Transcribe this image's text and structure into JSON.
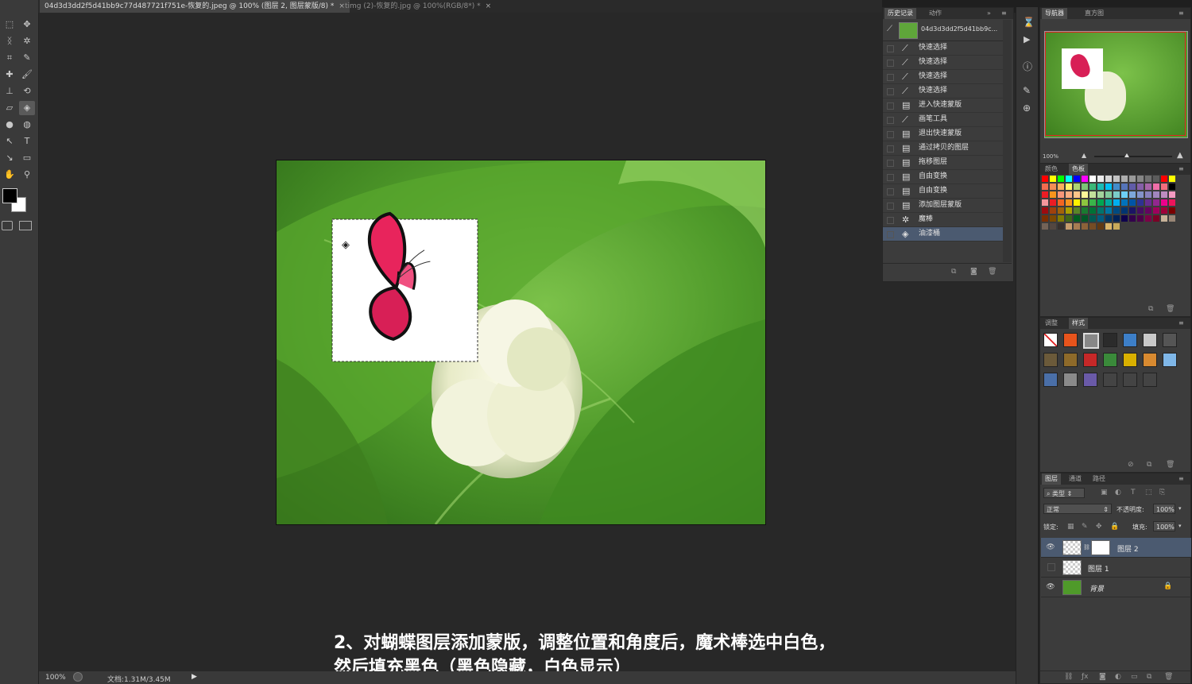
{
  "tabs": [
    {
      "label": "04d3d3dd2f5d41bb9c77d487721f751e-恢复的.jpeg @ 100% (图层 2, 图层蒙版/8) *",
      "close": "×"
    },
    {
      "label": "timg (2)-恢复的.jpg @ 100%(RGB/8*) *",
      "close": "×"
    }
  ],
  "toolbar": {
    "tools": [
      {
        "name": "rect-marquee-icon",
        "glyph": "⬚"
      },
      {
        "name": "move-icon",
        "glyph": "✥"
      },
      {
        "name": "lasso-icon",
        "glyph": "ᛝ"
      },
      {
        "name": "magic-wand-icon",
        "glyph": "✲"
      },
      {
        "name": "crop-icon",
        "glyph": "⌗"
      },
      {
        "name": "eyedropper-icon",
        "glyph": "✎"
      },
      {
        "name": "healing-brush-icon",
        "glyph": "✚"
      },
      {
        "name": "brush-icon",
        "glyph": "🖌"
      },
      {
        "name": "clone-stamp-icon",
        "glyph": "⊥"
      },
      {
        "name": "history-brush-icon",
        "glyph": "⟲"
      },
      {
        "name": "eraser-icon",
        "glyph": "▱"
      },
      {
        "name": "paint-bucket-icon",
        "glyph": "◈"
      },
      {
        "name": "blur-icon",
        "glyph": "●"
      },
      {
        "name": "dodge-icon",
        "glyph": "◍"
      },
      {
        "name": "path-select-icon",
        "glyph": "↖"
      },
      {
        "name": "type-icon",
        "glyph": "T"
      },
      {
        "name": "direct-select-icon",
        "glyph": "↘"
      },
      {
        "name": "shape-icon",
        "glyph": "▭"
      },
      {
        "name": "hand-icon",
        "glyph": "✋"
      },
      {
        "name": "zoom-icon",
        "glyph": "⚲"
      }
    ]
  },
  "history": {
    "tab_history": "历史记录",
    "tab_actions": "动作",
    "snapshot": "04d3d3dd2f5d41bb9c...",
    "items": [
      {
        "label": "快速选择",
        "icon": "quick-select-icon",
        "glyph": "⟋"
      },
      {
        "label": "快速选择",
        "icon": "quick-select-icon",
        "glyph": "⟋"
      },
      {
        "label": "快速选择",
        "icon": "quick-select-icon",
        "glyph": "⟋"
      },
      {
        "label": "快速选择",
        "icon": "quick-select-icon",
        "glyph": "⟋"
      },
      {
        "label": "进入快速蒙版",
        "icon": "history-state-icon",
        "glyph": "▤"
      },
      {
        "label": "画笔工具",
        "icon": "brush-icon",
        "glyph": "⟋"
      },
      {
        "label": "退出快速蒙版",
        "icon": "history-state-icon",
        "glyph": "▤"
      },
      {
        "label": "通过拷贝的图层",
        "icon": "history-state-icon",
        "glyph": "▤"
      },
      {
        "label": "拖移图层",
        "icon": "history-state-icon",
        "glyph": "▤"
      },
      {
        "label": "自由变换",
        "icon": "history-state-icon",
        "glyph": "▤"
      },
      {
        "label": "自由变换",
        "icon": "history-state-icon",
        "glyph": "▤"
      },
      {
        "label": "添加图层蒙版",
        "icon": "history-state-icon",
        "glyph": "▤"
      },
      {
        "label": "魔棒",
        "icon": "magic-wand-icon",
        "glyph": "✲"
      },
      {
        "label": "油漆桶",
        "icon": "paint-bucket-icon",
        "glyph": "◈"
      }
    ]
  },
  "navigator": {
    "tab_navigator": "导航器",
    "tab_histogram": "直方图",
    "zoom": "100%"
  },
  "swatches": {
    "tab_color": "颜色",
    "tab_swatches": "色板",
    "colors": [
      "#ff0000",
      "#ffff00",
      "#00ff00",
      "#00ffff",
      "#0000ff",
      "#ff00ff",
      "#ffffff",
      "#ebebeb",
      "#d6d6d6",
      "#c2c2c2",
      "#adadad",
      "#999999",
      "#858585",
      "#707070",
      "#5c5c5c",
      "#ff0000",
      "#ffff00",
      "#f26c4f",
      "#f68e55",
      "#fbaf5c",
      "#fff467",
      "#acd372",
      "#7cc576",
      "#3bb878",
      "#1abbb4",
      "#00bff3",
      "#438ccb",
      "#5574b9",
      "#605ca8",
      "#855fa8",
      "#a763a8",
      "#f06ea9",
      "#f26d7d",
      "#000000",
      "#ed1c24",
      "#f7941d",
      "#f69679",
      "#f9ad81",
      "#fdc689",
      "#fff799",
      "#c4df9b",
      "#a3d39c",
      "#82ca9c",
      "#7accc8",
      "#6dcff6",
      "#7da7d9",
      "#8393ca",
      "#8781bd",
      "#a186be",
      "#bd8cbf",
      "#f49ac1",
      "#f5989d",
      "#ed1c24",
      "#f26522",
      "#f7941d",
      "#fff200",
      "#8dc63f",
      "#39b54a",
      "#00a651",
      "#00a99d",
      "#00aeef",
      "#0072bc",
      "#0054a6",
      "#2e3192",
      "#662d91",
      "#92278f",
      "#ec008c",
      "#ed145b",
      "#9e0b0f",
      "#a0410d",
      "#a36209",
      "#aba000",
      "#598527",
      "#197b30",
      "#007236",
      "#00746b",
      "#0076a3",
      "#004a80",
      "#003471",
      "#1b1464",
      "#440e62",
      "#630460",
      "#9e005d",
      "#9e0039",
      "#790000",
      "#7b2e00",
      "#7d4900",
      "#827b00",
      "#406618",
      "#005e20",
      "#005826",
      "#005952",
      "#005b7f",
      "#003663",
      "#002157",
      "#0d004c",
      "#32004b",
      "#4b0049",
      "#7b0046",
      "#7a0026",
      "#c7b299",
      "#998675",
      "#736357",
      "#534741",
      "#37302d",
      "#c69c6d",
      "#a67c52",
      "#8c6239",
      "#754c24",
      "#603913",
      "#dab56a",
      "#c8a95a"
    ]
  },
  "styles": {
    "tab_adjust": "调整",
    "tab_styles": "样式",
    "colors": [
      "#ffffff",
      "#e8541c",
      "#888888",
      "#2b2b2b",
      "#3d7fc8",
      "#c9c9c9",
      "#555555",
      "#6b5a3a",
      "#8e6a2a",
      "#c62828",
      "#3a8a3a",
      "#d9b000",
      "#d88a30",
      "#7fb7e8",
      "#4a6fa8",
      "#8a8a8a",
      "#6a5aa8",
      "#444444",
      "#444444",
      "#444444"
    ]
  },
  "layers": {
    "tab_layers": "图层",
    "tab_channels": "通道",
    "tab_paths": "路径",
    "filter_kind": "类型",
    "blend_mode": "正常",
    "opacity_label": "不透明度:",
    "opacity_value": "100%",
    "lock_label": "锁定:",
    "fill_label": "填充:",
    "fill_value": "100%",
    "items": [
      {
        "name": "图层 2",
        "visible": true
      },
      {
        "name": "图层 1",
        "visible": false
      },
      {
        "name": "背景",
        "visible": true
      }
    ]
  },
  "status": {
    "zoom": "100%",
    "doc": "文档:1.31M/3.45M"
  },
  "caption": {
    "line1": "2、对蝴蝶图层添加蒙版，调整位置和角度后，魔术棒选中白色，",
    "line2": "然后填充黑色（黑色隐藏，白色显示）"
  }
}
